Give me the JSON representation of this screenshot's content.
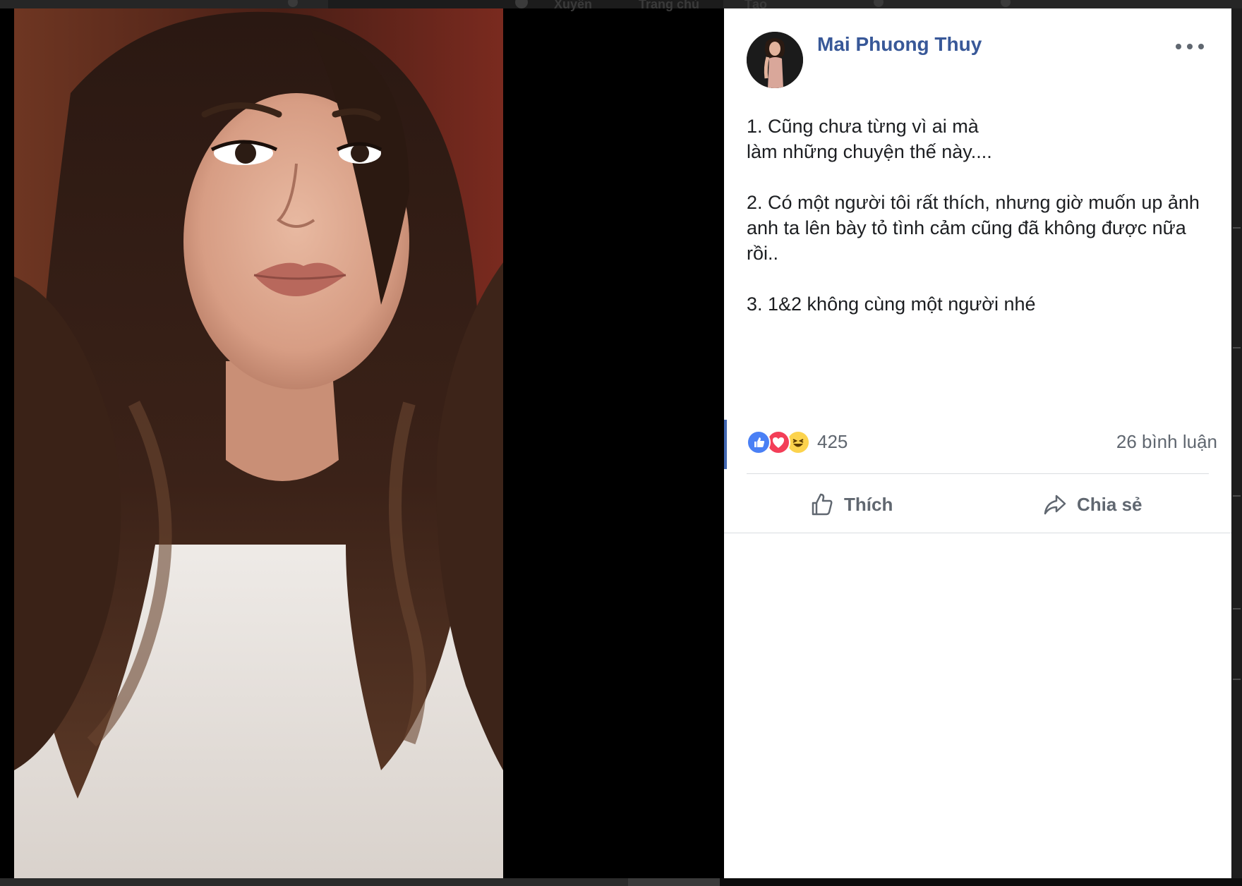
{
  "topbar": {
    "items": [
      "Xuyên",
      "Trang chủ",
      "Tạo"
    ]
  },
  "post": {
    "author_name": "Mai Phuong Thuy",
    "more_options_label": "",
    "paragraphs": [
      "1. Cũng chưa từng vì ai mà\nlàm những chuyện thế này....",
      "2. Có một người tôi rất thích, nhưng giờ muốn up ảnh anh ta lên bày tỏ tình cảm cũng đã không được nữa rồi..",
      "3. 1&2 không cùng một người nhé"
    ],
    "reactions": {
      "types": [
        "like-icon",
        "love-icon",
        "haha-icon"
      ],
      "count": "425"
    },
    "comment_count_label": "26 bình luận",
    "actions": {
      "like_label": "Thích",
      "share_label": "Chia sẻ"
    }
  },
  "colors": {
    "author_link": "#385898",
    "like_blue": "#4a80f5",
    "love_red": "#f33e58",
    "haha_yellow": "#fcd34d",
    "text": "#1c1e21",
    "muted": "#606770"
  }
}
